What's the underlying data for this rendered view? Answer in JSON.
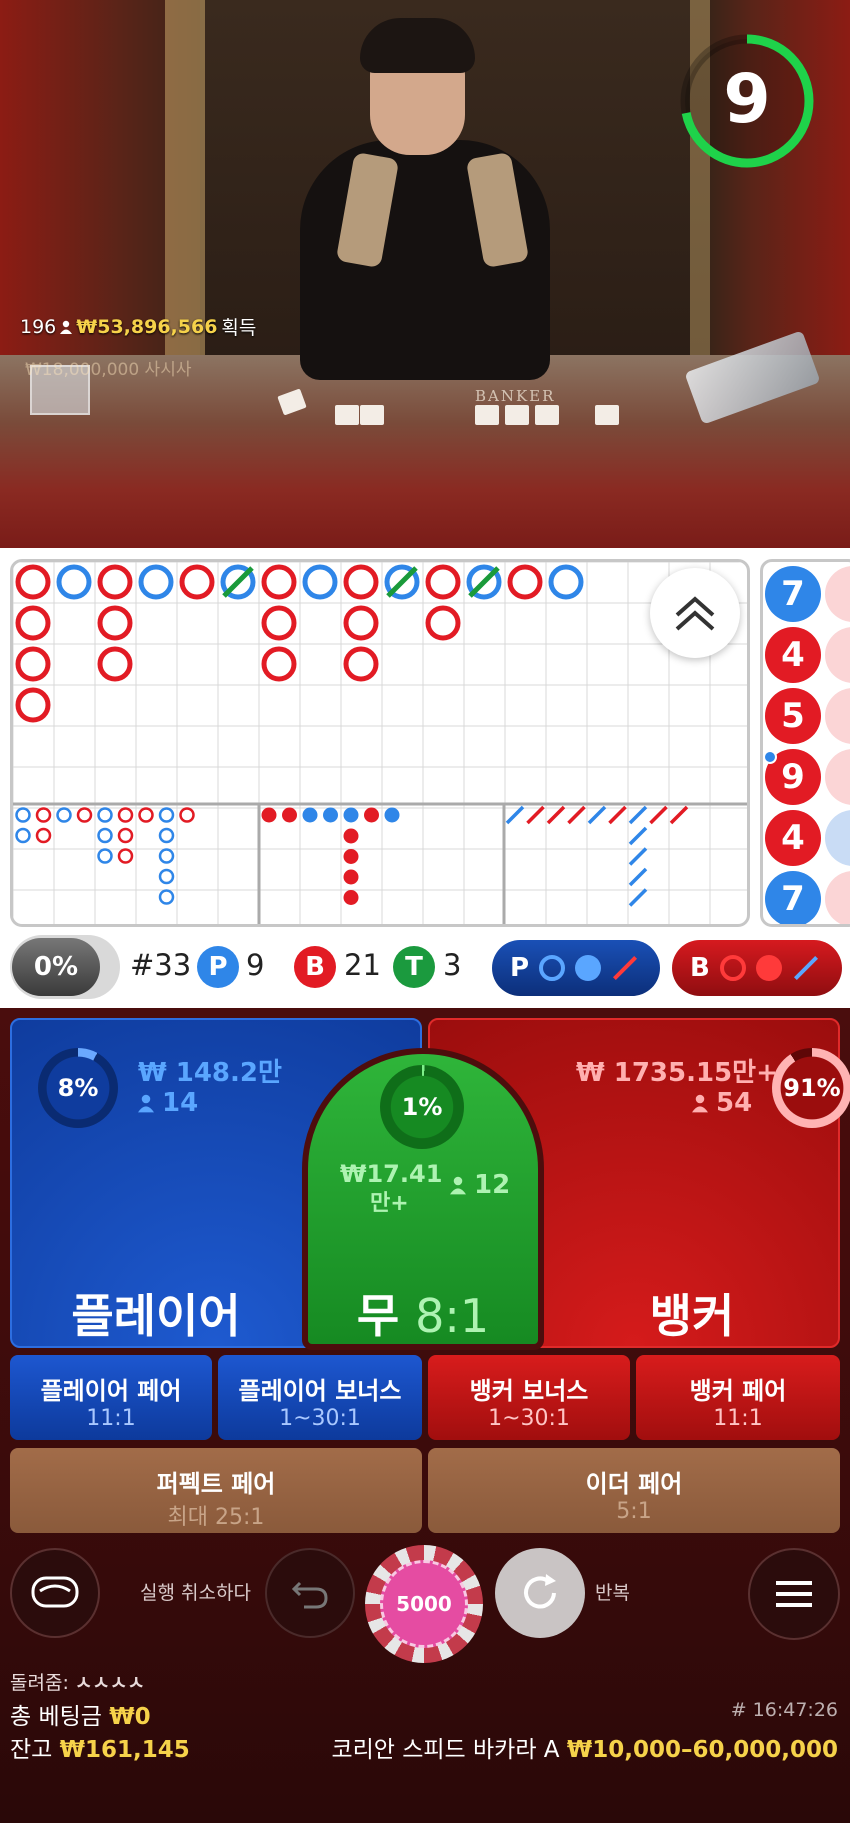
{
  "video": {
    "countdown": "9",
    "winners_count": "196",
    "winners_amount": "₩53,896,566",
    "winners_suffix": "획득",
    "ghost_text": "₩18,000,000 사시사",
    "banker_table_text": "BANKER"
  },
  "roadmap": {
    "bead_road": [
      {
        "value": "7",
        "side": "player"
      },
      {
        "value": "4",
        "side": "banker"
      },
      {
        "value": "5",
        "side": "banker"
      },
      {
        "value": "9",
        "side": "banker"
      },
      {
        "value": "4",
        "side": "banker"
      },
      {
        "value": "7",
        "side": "player"
      }
    ]
  },
  "stats": {
    "percent_toggle": "0%",
    "round": "#33",
    "player_letter": "P",
    "player_count": "9",
    "banker_letter": "B",
    "banker_count": "21",
    "tie_letter": "T",
    "tie_count": "3",
    "predict_player": "P",
    "predict_banker": "B"
  },
  "bets": {
    "player": {
      "label": "플레이어",
      "pct": "8%",
      "amount": "₩ 148.2만",
      "players": "14",
      "color": "#1e5ad0"
    },
    "tie": {
      "label": "무",
      "odds": "8:1",
      "pct": "1%",
      "amount_line1": "₩17.41",
      "amount_line2": "만+",
      "players": "12",
      "color": "#2fb53a"
    },
    "banker": {
      "label": "뱅커",
      "pct": "91%",
      "amount": "₩ 1735.15만+",
      "players": "54",
      "color": "#d51b1b"
    },
    "side": [
      {
        "label": "플레이어 페어",
        "odds": "11:1"
      },
      {
        "label": "플레이어 보너스",
        "odds": "1~30:1"
      },
      {
        "label": "뱅커 보너스",
        "odds": "1~30:1"
      },
      {
        "label": "뱅커 페어",
        "odds": "11:1"
      }
    ],
    "perfect_pair": {
      "label": "퍼펙트 페어",
      "odds": "최대 25:1"
    },
    "either_pair": {
      "label": "이더 페어",
      "odds": "5:1"
    }
  },
  "controls": {
    "undo_label": "실행 취소하다",
    "chip_value": "5000",
    "repeat_label": "반복"
  },
  "footer": {
    "hidden_label": "돌려줌:",
    "hidden_value": "ㅅㅅㅅㅅ",
    "total_bet_label": "총 베팅금",
    "total_bet_value": "₩0",
    "balance_label": "잔고",
    "balance_value": "₩161,145",
    "time": "# 16:47:26",
    "table_name": "코리안 스피드 바카라 A",
    "limits": "₩10,000–60,000,000"
  }
}
